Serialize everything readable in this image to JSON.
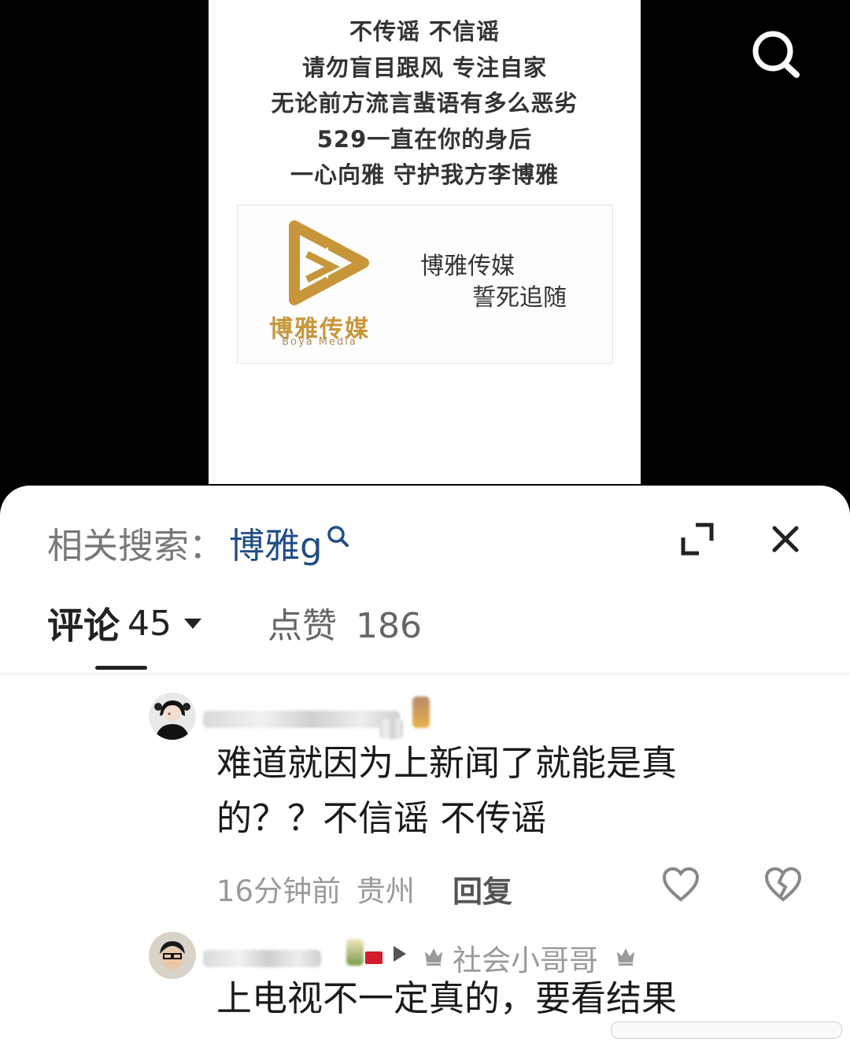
{
  "poster": {
    "lines": [
      "不传谣 不信谣",
      "请勿盲目跟风 专注自家",
      "无论前方流言蜚语有多么恶劣",
      "529一直在你的身后",
      "一心向雅 守护我方李博雅"
    ],
    "logo_name": "博雅传媒",
    "logo_sub": "Boya Media",
    "slogan_line1": "博雅传媒",
    "slogan_line2": "誓死追随",
    "logo_color": "#c8963a"
  },
  "header": {
    "search_icon": "search-icon",
    "related_label": "相关搜索：",
    "related_term": "博雅g",
    "related_term_color": "#1f4d86",
    "expand_icon": "expand-icon",
    "close_icon": "close-icon"
  },
  "tabs": {
    "comments_label": "评论",
    "comments_count": "45",
    "likes_label": "点赞",
    "likes_count": "186"
  },
  "comments": [
    {
      "text": "难道就因为上新闻了就能是真的？？不信谣 不传谣",
      "time": "16分钟前",
      "location": "贵州",
      "reply_label": "回复"
    },
    {
      "badge_name": "社会小哥哥",
      "text": "上电视不一定真的，要看结果"
    }
  ]
}
